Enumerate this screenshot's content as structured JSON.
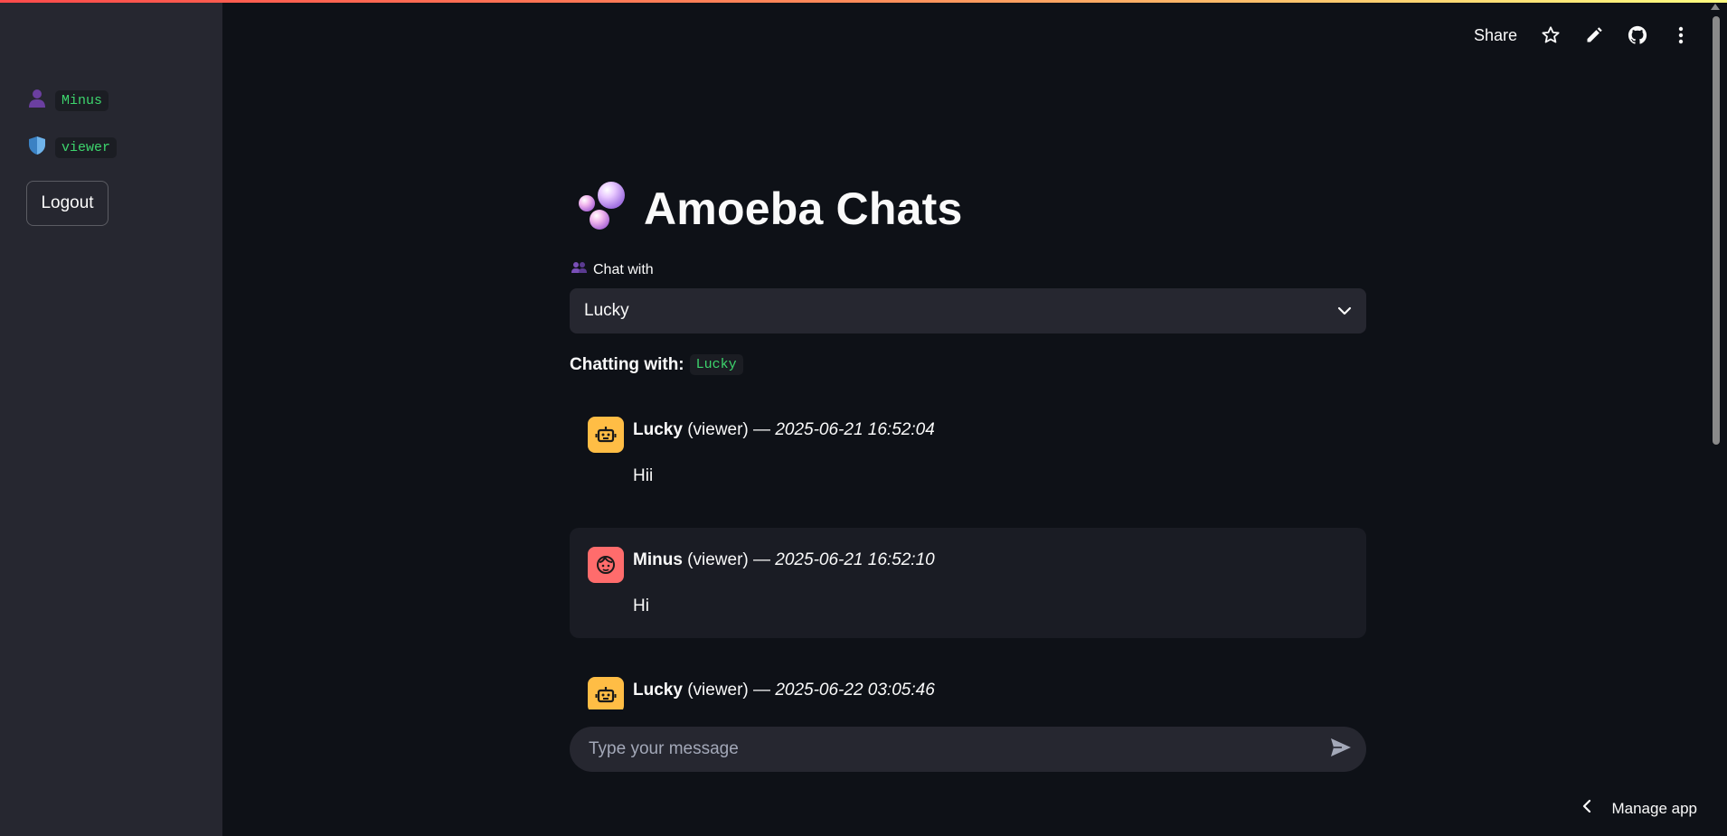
{
  "sidebar": {
    "username": "Minus",
    "role": "viewer",
    "logout_label": "Logout"
  },
  "toolbar": {
    "share_label": "Share",
    "icons": [
      "star-icon",
      "pencil-icon",
      "github-icon",
      "more-vertical-icon"
    ]
  },
  "page": {
    "title": "Amoeba Chats",
    "select_label": "Chat with",
    "selected_contact": "Lucky",
    "chatting_with_label": "Chatting with:",
    "chatting_with_value": "Lucky"
  },
  "messages": [
    {
      "name": "Lucky",
      "role": "(viewer)",
      "sep": " — ",
      "timestamp": "2025-06-21 16:52:04",
      "text": "Hii",
      "avatar": "robot-icon"
    },
    {
      "name": "Minus",
      "role": "(viewer)",
      "sep": " — ",
      "timestamp": "2025-06-21 16:52:10",
      "text": "Hi",
      "avatar": "face-icon"
    },
    {
      "name": "Lucky",
      "role": "(viewer)",
      "sep": " — ",
      "timestamp": "2025-06-22 03:05:46",
      "text": "",
      "avatar": "robot-icon"
    }
  ],
  "chat_input": {
    "placeholder": "Type your message"
  },
  "footer": {
    "manage_label": "Manage app"
  },
  "colors": {
    "background": "#0e1117",
    "sidebar": "#262730",
    "code_text": "#3dd56d",
    "bot_avatar": "#ffbd45",
    "user_avatar": "#ff6c6c"
  }
}
